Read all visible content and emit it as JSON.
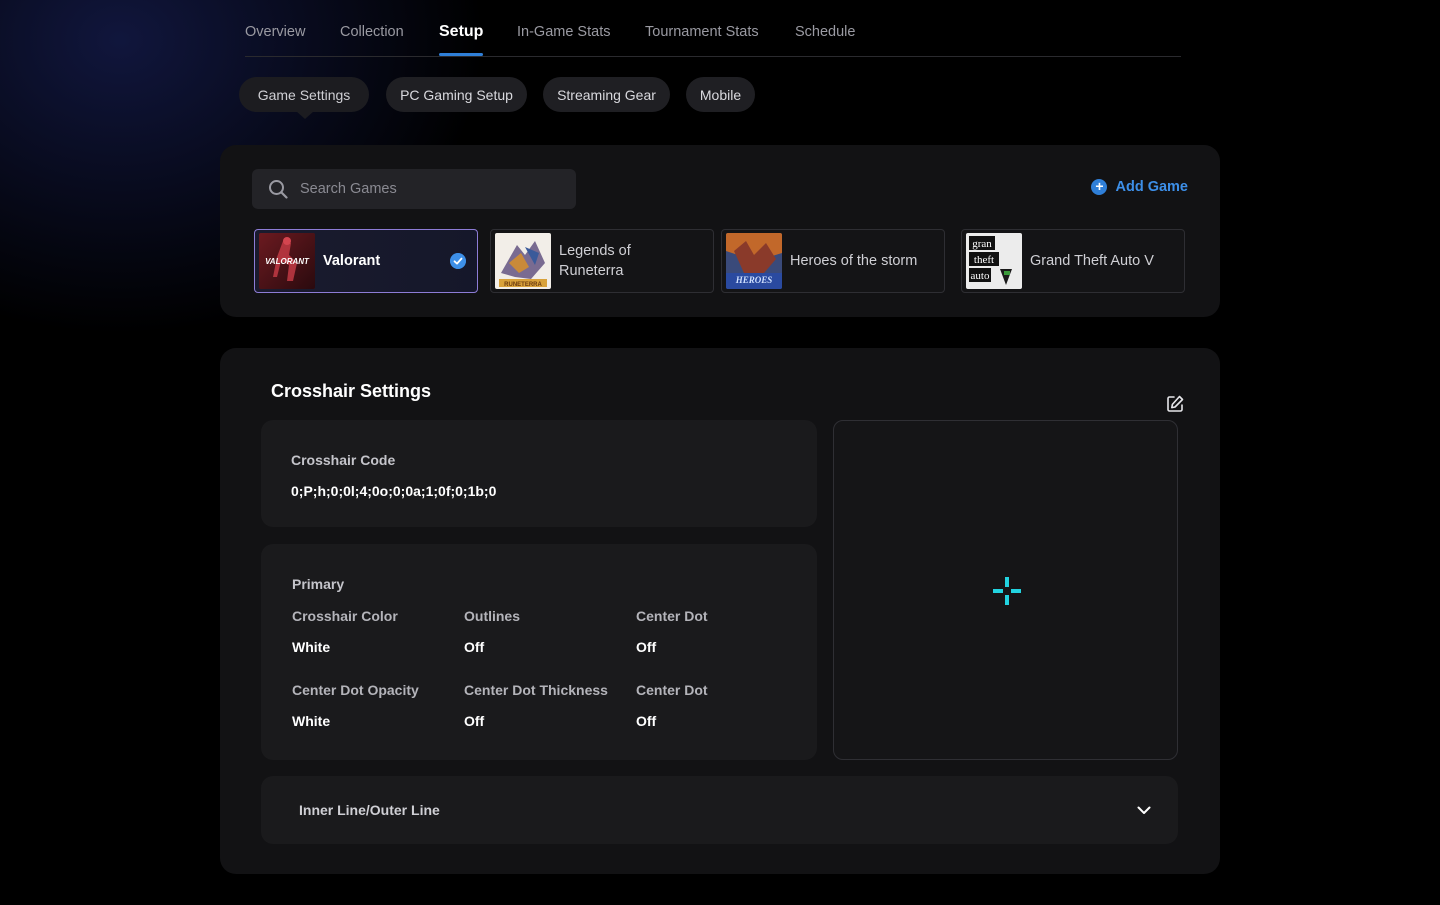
{
  "tabs": [
    {
      "label": "Overview"
    },
    {
      "label": "Collection"
    },
    {
      "label": "Setup",
      "active": true
    },
    {
      "label": "In-Game Stats"
    },
    {
      "label": "Tournament Stats"
    },
    {
      "label": "Schedule"
    }
  ],
  "subtabs": [
    {
      "label": "Game Settings",
      "active": true
    },
    {
      "label": "PC Gaming Setup"
    },
    {
      "label": "Streaming Gear"
    },
    {
      "label": "Mobile"
    }
  ],
  "games_panel": {
    "search_placeholder": "Search Games",
    "add_game_label": "Add Game",
    "games": [
      {
        "name": "Valorant",
        "selected": true
      },
      {
        "name": "Legends of Runeterra"
      },
      {
        "name": "Heroes of the storm"
      },
      {
        "name": "Grand Theft Auto V"
      }
    ]
  },
  "crosshair": {
    "title": "Crosshair Settings",
    "code_label": "Crosshair Code",
    "code_value": "0;P;h;0;0l;4;0o;0;0a;1;0f;0;1b;0",
    "primary_label": "Primary",
    "fields": [
      {
        "label": "Crosshair Color",
        "value": "White"
      },
      {
        "label": "Outlines",
        "value": "Off"
      },
      {
        "label": "Center Dot",
        "value": "Off"
      },
      {
        "label": "Center Dot Opacity",
        "value": "White"
      },
      {
        "label": "Center Dot Thickness",
        "value": "Off"
      },
      {
        "label": "Center Dot",
        "value": "Off"
      }
    ],
    "preview_color": "#22d3e0",
    "accordion_label": "Inner Line/Outer Line"
  },
  "colors": {
    "accent": "#2f7fd8",
    "selected_border": "#8d7cd6"
  }
}
